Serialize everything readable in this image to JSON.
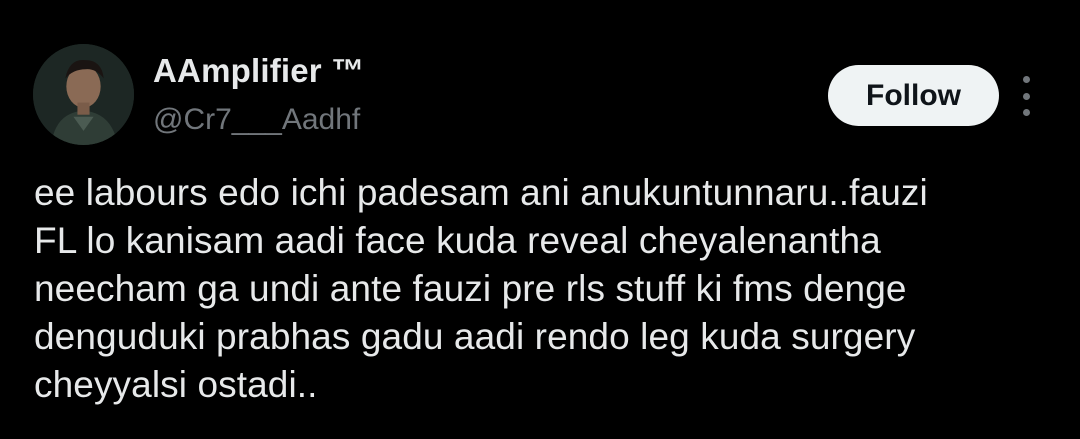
{
  "author": {
    "display_name": "AAmplifier ™",
    "handle": "@Cr7___Aadhf",
    "avatar_icon": "user-avatar-photo"
  },
  "actions": {
    "follow_label": "Follow",
    "more_icon": "more-vertical-icon"
  },
  "tweet": {
    "text": "ee labours edo ichi padesam ani anukuntunnaru..fauzi\nFL lo kanisam aadi face kuda reveal cheyalenantha\nneecham ga undi ante fauzi pre rls stuff ki fms denge\ndenguduki prabhas gadu aadi rendo leg kuda surgery\ncheyyalsi ostadi.."
  },
  "colors": {
    "background": "#000000",
    "primary_text": "#e7e9ea",
    "secondary_text": "#71767b",
    "follow_button_bg": "#eff3f4",
    "follow_button_text": "#0f1419"
  }
}
